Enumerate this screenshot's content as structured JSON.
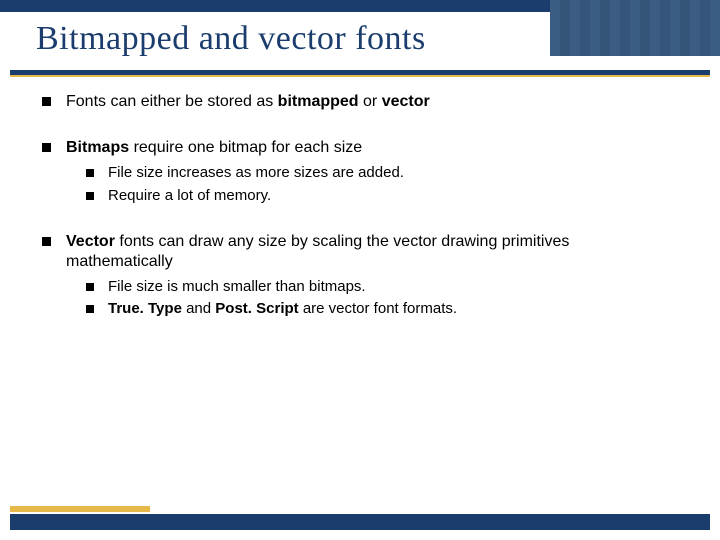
{
  "title": "Bitmapped and vector fonts",
  "bullets": [
    {
      "text_html": "Fonts can either be stored as <b>bitmapped</b> or <b>vector</b>",
      "children": []
    },
    {
      "text_html": "<b>Bitmaps</b> require one bitmap for each size",
      "children": [
        {
          "text_html": "File size increases as more sizes are added."
        },
        {
          "text_html": "Require a lot of memory."
        }
      ]
    },
    {
      "text_html": "<b>Vector</b> fonts can draw any size by scaling the vector drawing primitives mathematically",
      "children": [
        {
          "text_html": "File size is much smaller than bitmaps."
        },
        {
          "text_html": "<b>True. Type</b> and <b>Post. Script</b> are vector font formats."
        }
      ]
    }
  ]
}
